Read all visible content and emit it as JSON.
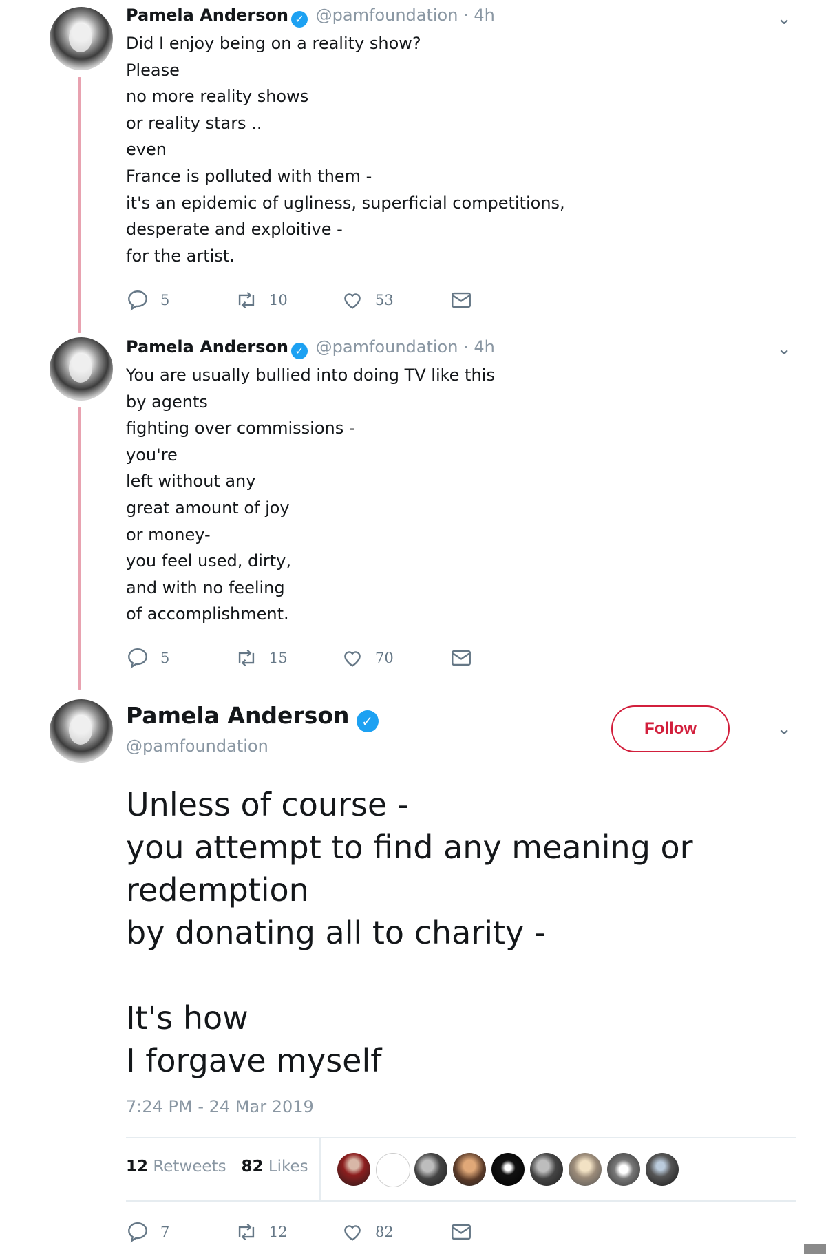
{
  "tweets": [
    {
      "name": "Pamela Anderson",
      "handle": "@pamfoundation",
      "time": "· 4h",
      "lines": [
        "Did I enjoy being on a reality show?",
        "Please",
        "no more reality shows",
        "or reality stars ..",
        "even",
        "France is polluted with them  -",
        "it's an epidemic of ugliness, superficial competitions,",
        "desperate and exploitive -",
        "for the artist."
      ],
      "replies": "5",
      "retweets": "10",
      "likes": "53"
    },
    {
      "name": "Pamela Anderson",
      "handle": "@pamfoundation",
      "time": "· 4h",
      "lines": [
        "You are usually bullied into doing TV like this",
        "by agents",
        "fighting over commissions -",
        "you're",
        "left without any",
        "great amount of joy",
        "or money-",
        "you feel used, dirty,",
        "and with no feeling",
        "of accomplishment."
      ],
      "replies": "5",
      "retweets": "15",
      "likes": "70"
    }
  ],
  "main_tweet": {
    "name": "Pamela Anderson",
    "handle": "@pamfoundation",
    "follow_label": "Follow",
    "lines": [
      "Unless of course -",
      "you attempt to find any meaning or",
      "redemption",
      "by donating all to charity -",
      "",
      "It's how",
      "I forgave myself"
    ],
    "timestamp": "7:24 PM - 24 Mar 2019",
    "retweet_count": "12",
    "retweets_label": "Retweets",
    "like_count": "82",
    "likes_label": "Likes",
    "replies": "7",
    "retweets": "12",
    "likes": "82"
  },
  "icons": {
    "reply": "reply-icon",
    "retweet": "retweet-icon",
    "like": "heart-icon",
    "dm": "envelope-icon",
    "more": "chevron-down-icon",
    "verified": "verified-badge-icon"
  },
  "colors": {
    "thread_line": "#e8a2b0",
    "verified": "#1da1f2",
    "follow_accent": "#d21f3c",
    "meta_text": "#8a97a3"
  }
}
